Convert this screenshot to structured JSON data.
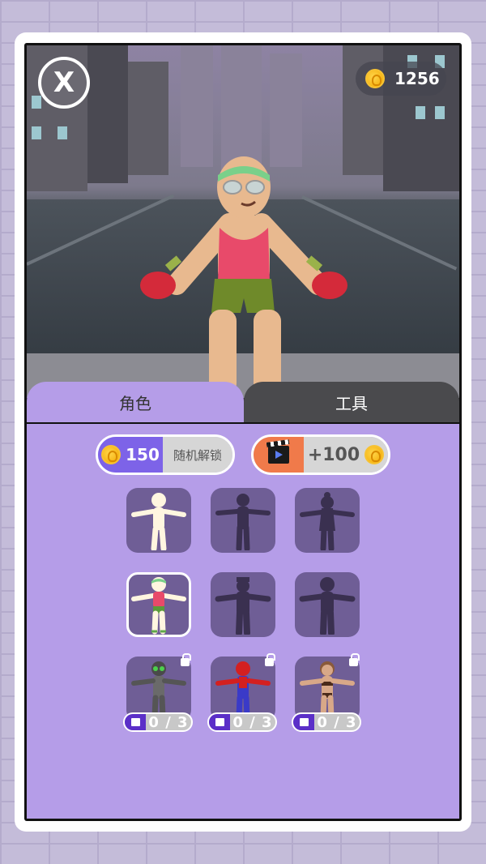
{
  "header": {
    "close_label": "X",
    "coins": "1256"
  },
  "tabs": [
    {
      "label": "角色",
      "active": true
    },
    {
      "label": "工具",
      "active": false
    }
  ],
  "unlock": {
    "random_price": "150",
    "random_label": "随机解锁",
    "ad_reward": "+100"
  },
  "characters": [
    {
      "name": "default",
      "state": "owned"
    },
    {
      "name": "silhouette-2",
      "state": "unknown"
    },
    {
      "name": "silhouette-3",
      "state": "unknown"
    },
    {
      "name": "headband-boxer",
      "state": "selected"
    },
    {
      "name": "silhouette-5",
      "state": "unknown"
    },
    {
      "name": "silhouette-6",
      "state": "unknown"
    },
    {
      "name": "goggles-robot",
      "state": "locked",
      "progress": "0 / 3"
    },
    {
      "name": "spider-hero",
      "state": "locked",
      "progress": "0 / 3"
    },
    {
      "name": "bikini-girl",
      "state": "locked",
      "progress": "0 / 3"
    }
  ],
  "colors": {
    "panel": "#b59de8",
    "slot": "#6f5e96",
    "coin": "#f2a800",
    "price_pill": "#7d63e8",
    "ad_pill": "#f07a4a"
  }
}
